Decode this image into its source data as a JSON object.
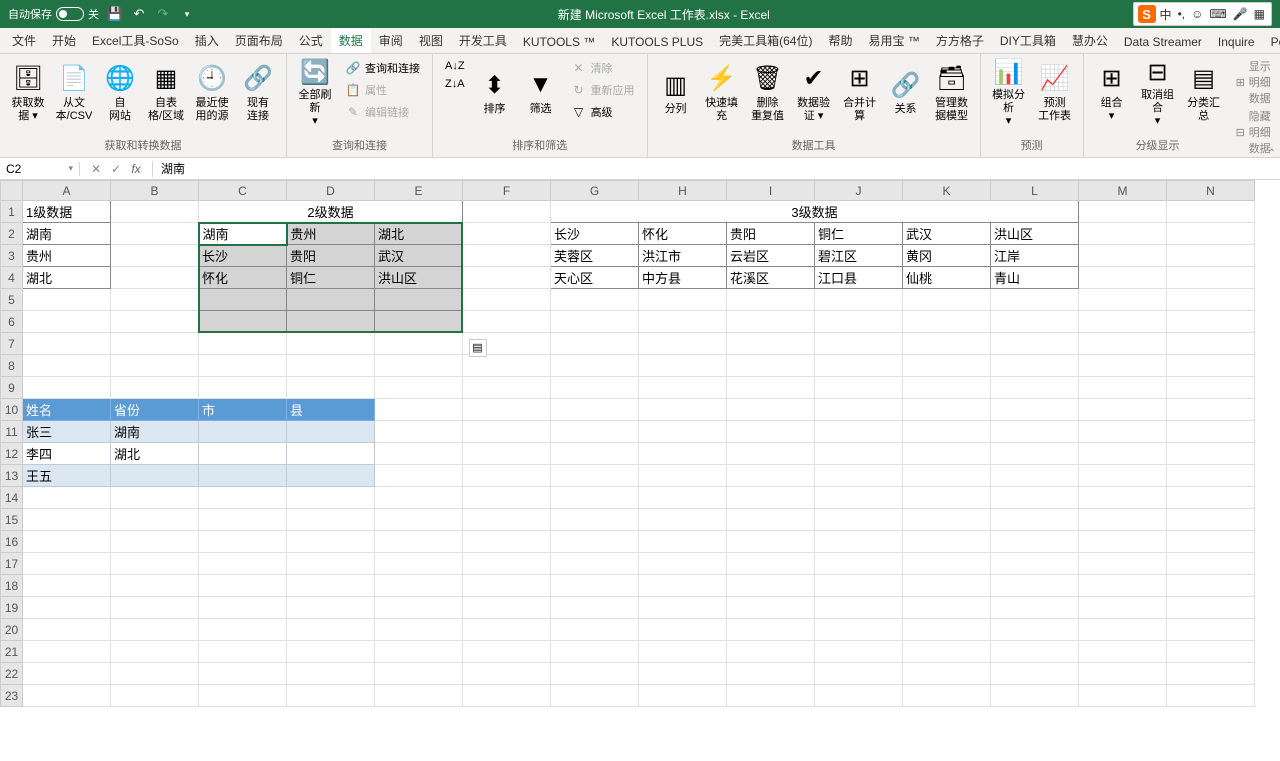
{
  "titlebar": {
    "autosave_label": "自动保存",
    "autosave_state": "关",
    "title": "新建 Microsoft Excel 工作表.xlsx  -  Excel"
  },
  "ime": {
    "logo": "S",
    "lang": "中"
  },
  "tabs": [
    "文件",
    "开始",
    "Excel工具-SoSo",
    "插入",
    "页面布局",
    "公式",
    "数据",
    "审阅",
    "视图",
    "开发工具",
    "KUTOOLS ™",
    "KUTOOLS PLUS",
    "完美工具箱(64位)",
    "帮助",
    "易用宝 ™",
    "方方格子",
    "DIY工具箱",
    "慧办公",
    "Data Streamer",
    "Inquire",
    "Power Pivot"
  ],
  "active_tab": "数据",
  "ribbon": {
    "g1": {
      "label": "获取和转换数据",
      "btns": [
        "获取数\n据 ▾",
        "从文\n本/CSV",
        "自\n网站",
        "自表\n格/区域",
        "最近使\n用的源",
        "现有\n连接"
      ]
    },
    "g2": {
      "label": "查询和连接",
      "refresh": "全部刷新\n▾",
      "items": [
        "查询和连接",
        "属性",
        "编辑链接"
      ]
    },
    "g3": {
      "label": "排序和筛选",
      "sort_az": "A↓Z",
      "sort_za": "Z↓A",
      "sort": "排序",
      "filter": "筛选",
      "clear": "清除",
      "reapply": "重新应用",
      "advanced": "高级"
    },
    "g4": {
      "label": "数据工具",
      "btns": [
        "分列",
        "快速填充",
        "删除\n重复值",
        "数据验\n证 ▾",
        "合并计算",
        "关系",
        "管理数\n据模型"
      ]
    },
    "g5": {
      "label": "预测",
      "btns": [
        "模拟分析\n▾",
        "预测\n工作表"
      ]
    },
    "g6": {
      "label": "分级显示",
      "btns": [
        "组合\n▾",
        "取消组合\n▾",
        "分类汇总"
      ],
      "side": [
        "显示明细数据",
        "隐藏明细数据"
      ]
    }
  },
  "formula_bar": {
    "name_box": "C2",
    "value": "湖南"
  },
  "columns": [
    "A",
    "B",
    "C",
    "D",
    "E",
    "F",
    "G",
    "H",
    "I",
    "J",
    "K",
    "L",
    "M",
    "N"
  ],
  "cells": {
    "A1": "1级数据",
    "A2": "湖南",
    "A3": "贵州",
    "A4": "湖北",
    "C1_merge": "2级数据",
    "C2": "湖南",
    "D2": "贵州",
    "E2": "湖北",
    "C3": "长沙",
    "D3": "贵阳",
    "E3": "武汉",
    "C4": "怀化",
    "D4": "铜仁",
    "E4": "洪山区",
    "G1_merge": "3级数据",
    "G2": "长沙",
    "H2": "怀化",
    "I2": "贵阳",
    "J2": "铜仁",
    "K2": "武汉",
    "L2": "洪山区",
    "G3": "芙蓉区",
    "H3": "洪江市",
    "I3": "云岩区",
    "J3": "碧江区",
    "K3": "黄冈",
    "L3": "江岸",
    "G4": "天心区",
    "H4": "中方县",
    "I4": "花溪区",
    "J4": "江口县",
    "K4": "仙桃",
    "L4": "青山",
    "A10": "姓名",
    "B10": "省份",
    "C10": "市",
    "D10": "县",
    "A11": "张三",
    "B11": "湖南",
    "A12": "李四",
    "B12": "湖北",
    "A13": "王五"
  }
}
